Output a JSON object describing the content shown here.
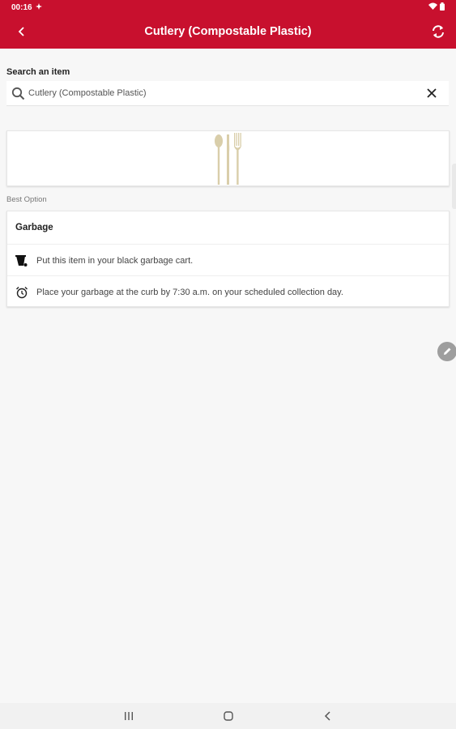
{
  "status_bar": {
    "time": "00:16"
  },
  "app_bar": {
    "title": "Cutlery (Compostable Plastic)",
    "accent_color": "#c8102e"
  },
  "search": {
    "label": "Search an item",
    "value": "Cutlery (Compostable Plastic)"
  },
  "item_image": {
    "icon": "cutlery-icon"
  },
  "best_option_label": "Best Option",
  "result": {
    "category": "Garbage",
    "instructions": [
      {
        "icon": "garbage-cart-icon",
        "text": "Put this item in your black garbage cart."
      },
      {
        "icon": "alarm-clock-icon",
        "text": "Place your garbage at the curb by 7:30 a.m. on your scheduled collection day."
      }
    ]
  },
  "icons": {
    "back": "back-arrow-icon",
    "refresh": "refresh-icon",
    "search": "search-icon",
    "clear": "close-icon",
    "edit": "pencil-icon"
  },
  "nav_bar": {
    "items": [
      "recent-apps-icon",
      "home-icon",
      "back-icon"
    ]
  }
}
